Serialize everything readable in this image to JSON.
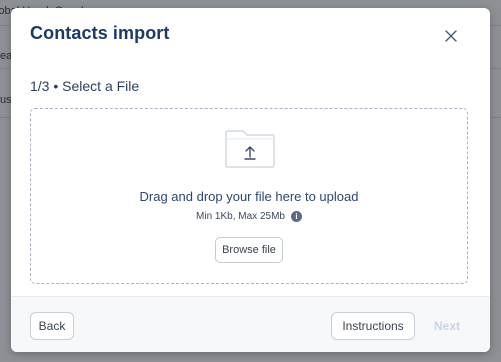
{
  "background": {
    "row_texts": [
      "lobal Head, Oncology",
      "ea",
      "us"
    ]
  },
  "modal": {
    "title": "Contacts import",
    "close_icon": "close-icon",
    "step_label": "1/3 • Select a File",
    "dropzone": {
      "icon": "folder-upload-icon",
      "instruction": "Drag and drop your file here to upload",
      "limits": "Min 1Kb, Max 25Mb",
      "info_icon": "info-icon",
      "browse_label": "Browse file"
    },
    "footer": {
      "back_label": "Back",
      "instructions_label": "Instructions",
      "next_label": "Next"
    }
  },
  "colors": {
    "title": "#1c3a66",
    "next_disabled": "#c7d4e8",
    "dropzone_border": "#a9b3c3"
  }
}
